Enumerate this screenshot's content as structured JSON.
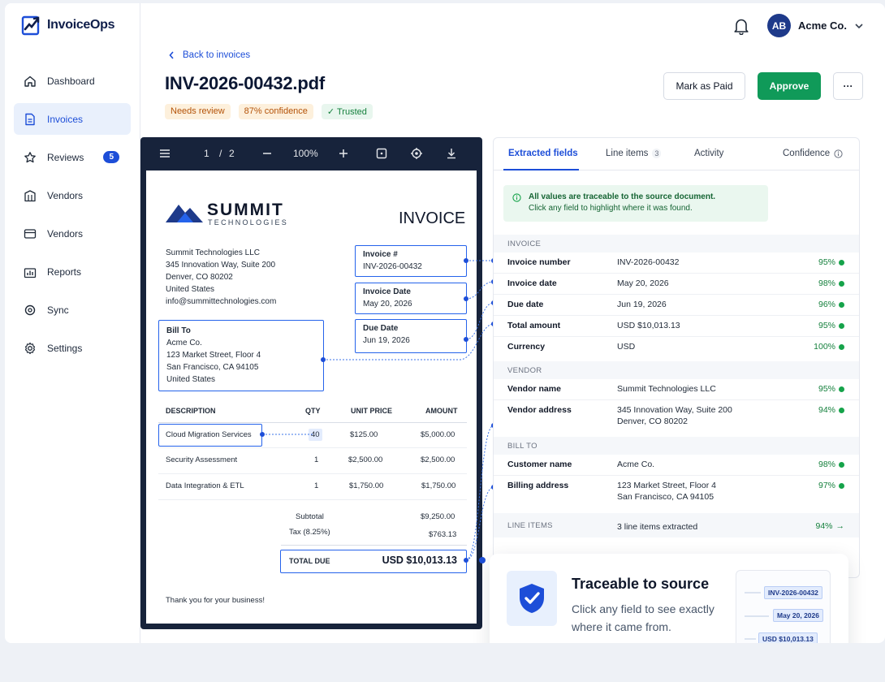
{
  "app": {
    "name": "InvoiceOps"
  },
  "sidebar": {
    "items": [
      {
        "label": "Dashboard"
      },
      {
        "label": "Invoices"
      },
      {
        "label": "Reviews",
        "badge": "5"
      },
      {
        "label": "Vendors"
      },
      {
        "label": "Vendors"
      },
      {
        "label": "Reports"
      },
      {
        "label": "Sync"
      },
      {
        "label": "Settings"
      }
    ]
  },
  "header": {
    "avatar_initials": "AB",
    "account": "Acme Co."
  },
  "page": {
    "back_label": "Back to invoices",
    "title": "INV-2026-00432.pdf",
    "tags": {
      "status": "Needs review",
      "confidence": "87% confidence",
      "trusted": "Trusted"
    },
    "actions": {
      "mark_paid": "Mark as Paid",
      "approve": "Approve",
      "more": "···"
    }
  },
  "viewer": {
    "page": "1",
    "total_pages": "2",
    "zoom": "100%",
    "document": {
      "brand": "SUMMIT",
      "brand_sub": "TECHNOLOGIES",
      "heading": "INVOICE",
      "from": "Summit Technologies LLC\n345 Innovation Way, Suite 200\nDenver, CO 80202\nUnited States\ninfo@summittechnologies.com",
      "from_name": "Summit Technologies LLC",
      "invoice_no_label": "Invoice #",
      "invoice_no": "INV-2026-00432",
      "invoice_date_label": "Invoice Date",
      "invoice_date": "May 20, 2026",
      "due_date_label": "Due Date",
      "due_date": "Jun 19, 2026",
      "bill_to_label": "Bill To",
      "bill_to": "Acme Co.\n123 Market Street, Floor 4\nSan Francisco, CA 94105\nUnited States",
      "columns": [
        "DESCRIPTION",
        "QTY",
        "UNIT PRICE",
        "AMOUNT"
      ],
      "lines": [
        {
          "description": "Cloud Migration Services",
          "qty": "40",
          "unit_price": "$125.00",
          "amount": "$5,000.00"
        },
        {
          "description": "Security Assessment",
          "qty": "1",
          "unit_price": "$2,500.00",
          "amount": "$2,500.00"
        },
        {
          "description": "Data Integration & ETL",
          "qty": "1",
          "unit_price": "$1,750.00",
          "amount": "$1,750.00"
        }
      ],
      "subtotal_label": "Subtotal",
      "subtotal": "$9,250.00",
      "tax_label": "Tax (8.25%)",
      "tax": "$763.13",
      "total_label": "TOTAL DUE",
      "total": "USD $10,013.13",
      "footer": "Thank you for your business!"
    }
  },
  "panel": {
    "tabs": [
      {
        "label": "Extracted fields"
      },
      {
        "label": "Line items",
        "count": "3"
      },
      {
        "label": "Activity"
      },
      {
        "label": "Confidence"
      }
    ],
    "notice_line1": "All values are traceable to the source document.",
    "notice_line2": "Click any field to highlight where it was found.",
    "sections": {
      "invoice": "INVOICE",
      "vendor": "VENDOR",
      "bill_to": "BILL TO",
      "line_items": "LINE ITEMS"
    },
    "fields": [
      {
        "label": "Invoice number",
        "value": "INV-2026-00432",
        "confidence": "95%"
      },
      {
        "label": "Invoice date",
        "value": "May 20, 2026",
        "confidence": "98%"
      },
      {
        "label": "Due date",
        "value": "Jun 19, 2026",
        "confidence": "96%"
      },
      {
        "label": "Total amount",
        "value": "USD $10,013.13",
        "confidence": "95%"
      },
      {
        "label": "Currency",
        "value": "USD",
        "confidence": "100%"
      },
      {
        "label": "Vendor name",
        "value": "Summit Technologies LLC",
        "confidence": "95%"
      },
      {
        "label": "Vendor address",
        "value": "345 Innovation Way, Suite 200\nDenver, CO 80202",
        "confidence": "94%"
      },
      {
        "label": "Customer name",
        "value": "Acme Co.",
        "confidence": "98%"
      },
      {
        "label": "Billing address",
        "value": "123 Market Street, Floor 4\nSan Francisco, CA 94105",
        "confidence": "97%"
      }
    ],
    "line_items_summary": "3 line items extracted",
    "line_items_confidence": "94%"
  },
  "callout": {
    "title": "Traceable to source",
    "body": "Click any field to see exactly where it came from.",
    "chips": [
      "INV-2026-00432",
      "May 20, 2026",
      "USD $10,013.13"
    ]
  },
  "colors": {
    "accent": "#1d4ed8",
    "success": "#109a59",
    "warning": "#b45309",
    "viewer_bg": "#17233b"
  }
}
